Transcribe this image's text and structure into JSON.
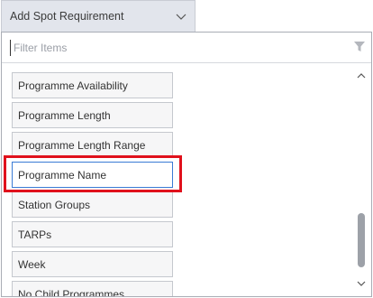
{
  "dropdown": {
    "label": "Add Spot Requirement",
    "icon": "chevron-down-icon"
  },
  "filter": {
    "placeholder": "Filter Items",
    "value": "",
    "icon": "funnel-icon"
  },
  "items": [
    {
      "label": "Programme Availability"
    },
    {
      "label": "Programme Length"
    },
    {
      "label": "Programme Length Range"
    },
    {
      "label": "Programme Name",
      "selected": true
    },
    {
      "label": "Station Groups"
    },
    {
      "label": "TARPs"
    },
    {
      "label": "Week"
    },
    {
      "label": "No Child Programmes"
    }
  ],
  "colors": {
    "highlight": "#e0111c",
    "selected_border": "#3a7bd5",
    "dropdown_bg": "#e2e5ec"
  }
}
